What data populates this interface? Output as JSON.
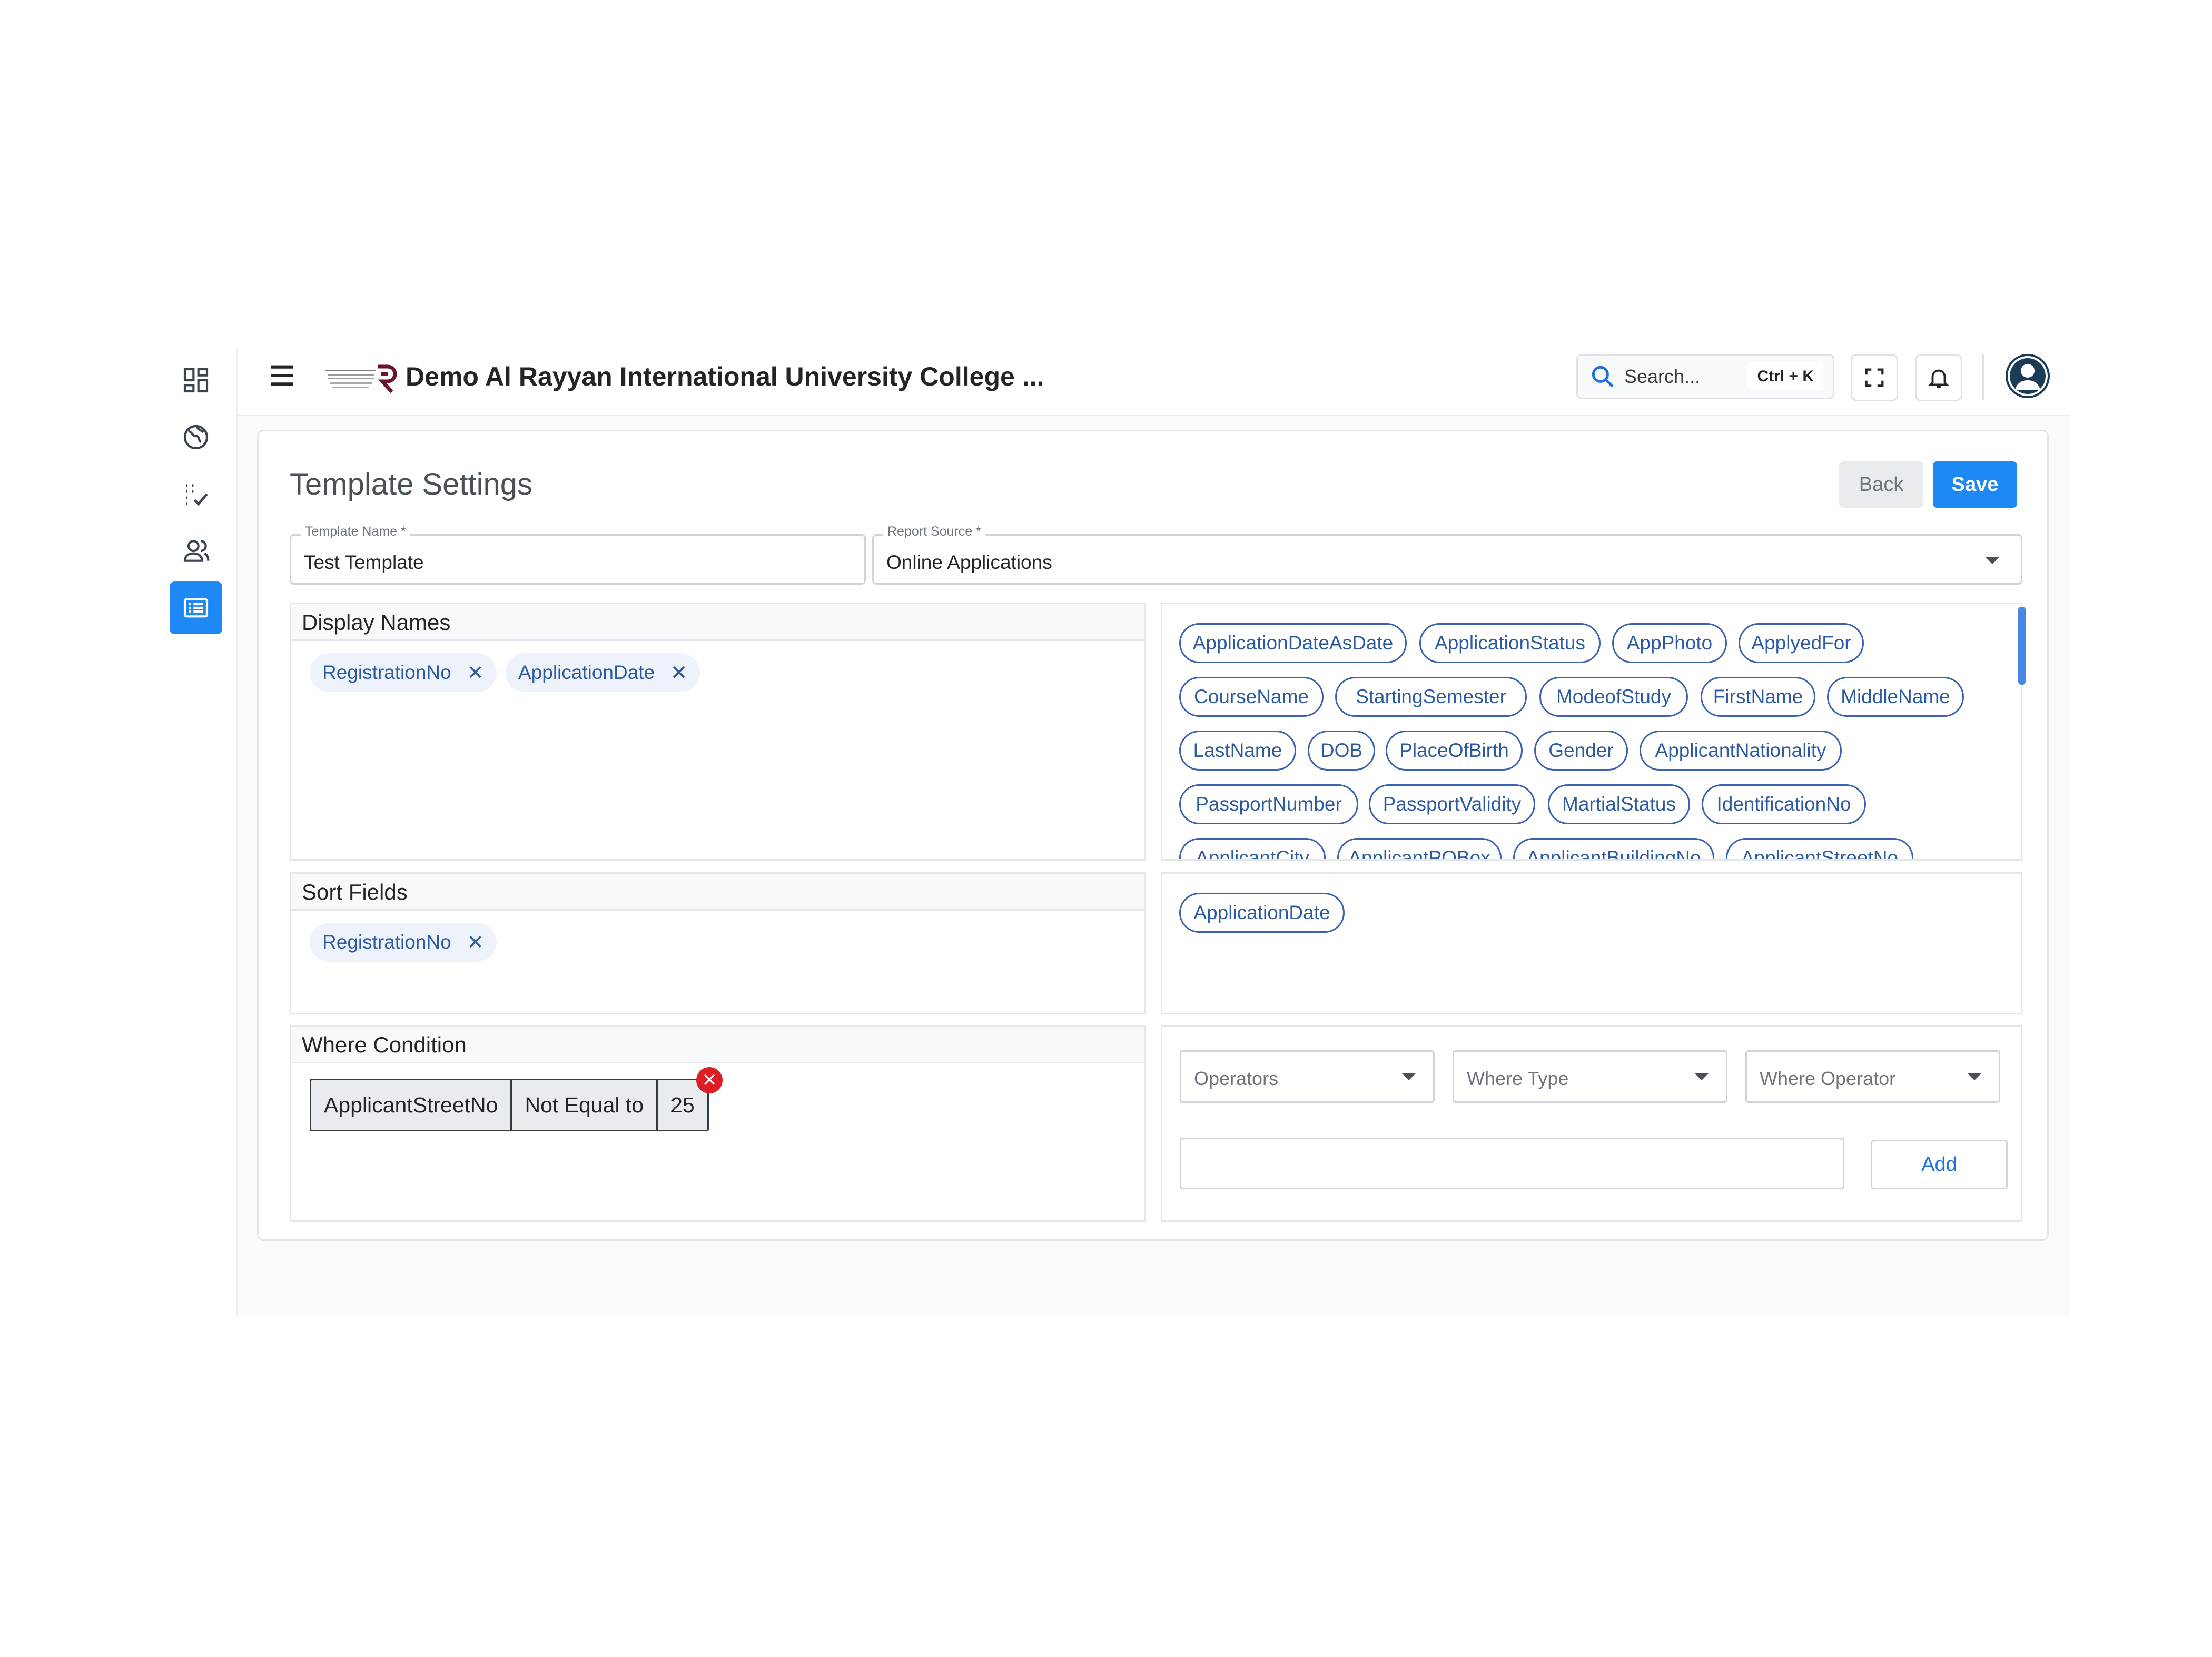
{
  "header": {
    "app_title": "Demo Al Rayyan International University College ...",
    "search_placeholder": "Search...",
    "search_shortcut": "Ctrl + K"
  },
  "page": {
    "title": "Template Settings",
    "back_label": "Back",
    "save_label": "Save"
  },
  "form": {
    "template_name_label": "Template Name *",
    "template_name_value": "Test Template",
    "report_source_label": "Report Source *",
    "report_source_value": "Online Applications"
  },
  "display_names": {
    "title": "Display Names",
    "selected": [
      "RegistrationNo",
      "ApplicationDate"
    ]
  },
  "available_fields": [
    "ApplicationDateAsDate",
    "ApplicationStatus",
    "AppPhoto",
    "ApplyedFor",
    "CourseName",
    "StartingSemester",
    "ModeofStudy",
    "FirstName",
    "MiddleName",
    "LastName",
    "DOB",
    "PlaceOfBirth",
    "Gender",
    "ApplicantNationality",
    "PassportNumber",
    "PassportValidity",
    "MartialStatus",
    "IdentificationNo",
    "ApplicantCity",
    "ApplicantPOBox",
    "ApplicantBuildingNo",
    "ApplicantStreetNo"
  ],
  "sort_fields": {
    "title": "Sort Fields",
    "selected": [
      "RegistrationNo"
    ],
    "available": [
      "ApplicationDate"
    ]
  },
  "where_condition": {
    "title": "Where Condition",
    "condition": {
      "field": "ApplicantStreetNo",
      "operator": "Not Equal to",
      "value": "25"
    },
    "operators_placeholder": "Operators",
    "where_type_placeholder": "Where Type",
    "where_operator_placeholder": "Where Operator",
    "value_input": "",
    "add_label": "Add"
  },
  "colors": {
    "primary": "#1e88f5",
    "chip_border": "#3a62b0",
    "chip_text": "#2c5aa0",
    "remove_badge": "#dc1f26"
  }
}
